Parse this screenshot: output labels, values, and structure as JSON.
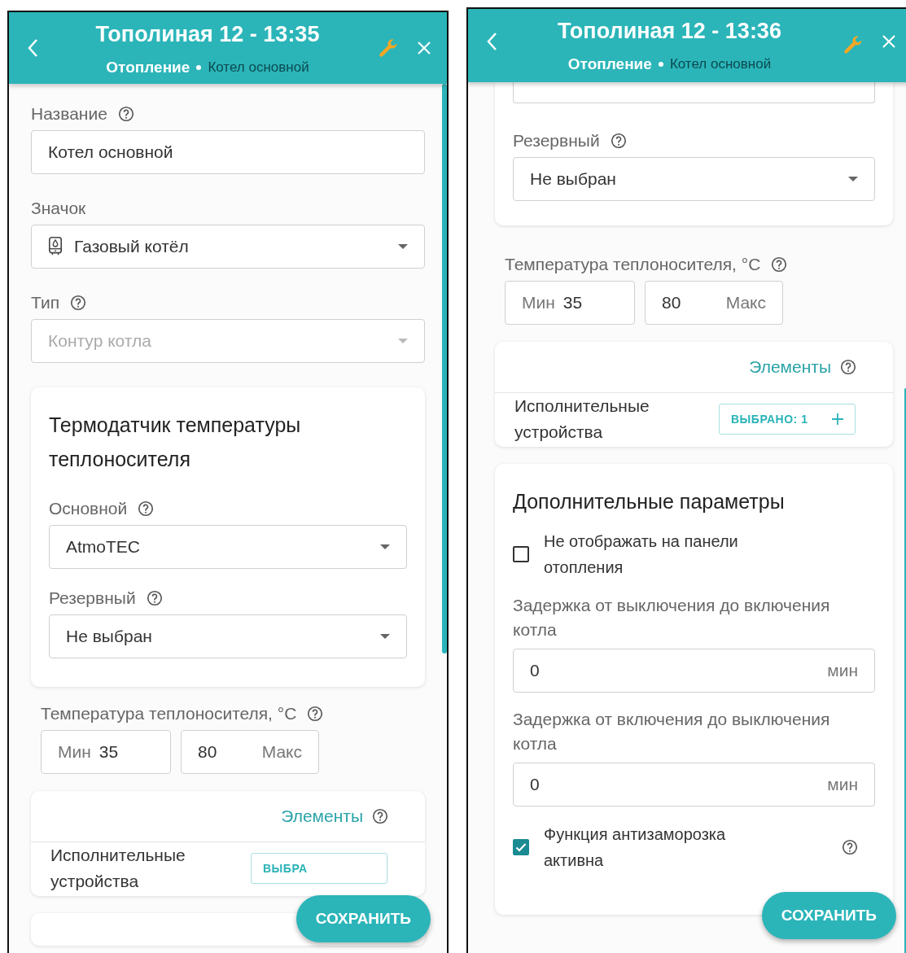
{
  "screens": [
    {
      "header": {
        "title": "Тополиная 12 - 13:35",
        "section": "Отопление",
        "item": "Котел основной"
      },
      "blocks": [
        {
          "kind": "text",
          "label": "Название",
          "help": true,
          "value": "Котел основной"
        },
        {
          "kind": "select",
          "label": "Значок",
          "icon": true,
          "value": "Газовый котёл",
          "disabled": false
        },
        {
          "kind": "select",
          "label": "Тип",
          "help": true,
          "value": "Контур котла",
          "disabled": true
        },
        {
          "kind": "card",
          "title": "Термодатчик температуры теплоносителя",
          "children": [
            {
              "kind": "select",
              "label": "Основной",
              "help": true,
              "value": "AtmoTEC",
              "disabled": false
            },
            {
              "kind": "select",
              "label": "Резервный",
              "help": true,
              "value": "Не выбран",
              "disabled": false
            }
          ]
        },
        {
          "kind": "range",
          "label": "Температура теплоносителя, °C",
          "help": true,
          "min_label": "Мин",
          "min": "35",
          "max": "80",
          "max_label": "Макс"
        },
        {
          "kind": "elements",
          "title": "Элементы",
          "row_label": "Исполнительные устройства",
          "button": "ВЫБРА",
          "plus": false
        },
        {
          "kind": "card-edge"
        }
      ],
      "save": "СОХРАНИТЬ"
    },
    {
      "header": {
        "title": "Тополиная 12 - 13:36",
        "section": "Отопление",
        "item": "Котел основной"
      },
      "blocks": [
        {
          "kind": "card",
          "cut_top": true,
          "children": [
            {
              "kind": "select-cut"
            },
            {
              "kind": "select",
              "label": "Резервный",
              "help": true,
              "value": "Не выбран",
              "disabled": false
            }
          ]
        },
        {
          "kind": "range",
          "label": "Температура теплоносителя, °C",
          "help": true,
          "min_label": "Мин",
          "min": "35",
          "max": "80",
          "max_label": "Макс"
        },
        {
          "kind": "elements",
          "title": "Элементы",
          "row_label": "Исполнительные устройства",
          "button": "ВЫБРАНО: 1",
          "plus": true
        },
        {
          "kind": "card",
          "title": "Дополнительные параметры",
          "children": [
            {
              "kind": "checkbox",
              "label": "Не отображать на панели отопления",
              "checked": false
            },
            {
              "kind": "unit-field",
              "label": "Задержка от выключения до включения котла",
              "value": "0",
              "unit": "мин"
            },
            {
              "kind": "unit-field",
              "label": "Задержка от включения до выключения котла",
              "value": "0",
              "unit": "мин"
            },
            {
              "kind": "checkbox",
              "label": "Функция антизаморозка активна",
              "checked": true,
              "help": true
            }
          ]
        }
      ],
      "save": "СОХРАНИТЬ"
    }
  ]
}
